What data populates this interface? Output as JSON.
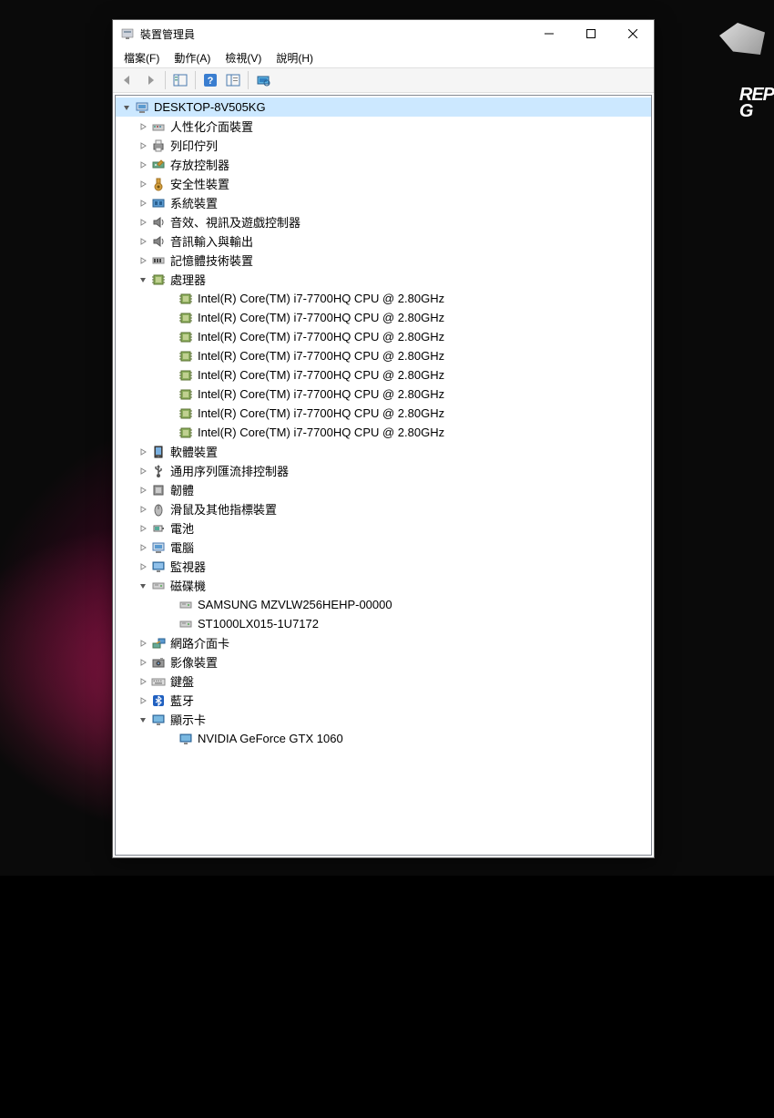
{
  "desktop": {
    "rog_text_line1": "REP",
    "rog_text_line2": "G"
  },
  "window": {
    "title": "裝置管理員"
  },
  "menu": {
    "file": "檔案(F)",
    "action": "動作(A)",
    "view": "檢視(V)",
    "help": "說明(H)"
  },
  "tree": {
    "root": "DESKTOP-8V505KG",
    "nodes": [
      {
        "label": "人性化介面裝置",
        "icon": "hid",
        "expanded": false
      },
      {
        "label": "列印佇列",
        "icon": "printer",
        "expanded": false
      },
      {
        "label": "存放控制器",
        "icon": "storage-ctrl",
        "expanded": false
      },
      {
        "label": "安全性裝置",
        "icon": "security",
        "expanded": false
      },
      {
        "label": "系統裝置",
        "icon": "system",
        "expanded": false
      },
      {
        "label": "音效、視訊及遊戯控制器",
        "icon": "audio",
        "expanded": false
      },
      {
        "label": "音訊輸入與輸出",
        "icon": "audio-io",
        "expanded": false
      },
      {
        "label": "記憶體技術裝置",
        "icon": "memory",
        "expanded": false
      },
      {
        "label": "處理器",
        "icon": "cpu",
        "expanded": true,
        "children": [
          "Intel(R) Core(TM) i7-7700HQ CPU @ 2.80GHz",
          "Intel(R) Core(TM) i7-7700HQ CPU @ 2.80GHz",
          "Intel(R) Core(TM) i7-7700HQ CPU @ 2.80GHz",
          "Intel(R) Core(TM) i7-7700HQ CPU @ 2.80GHz",
          "Intel(R) Core(TM) i7-7700HQ CPU @ 2.80GHz",
          "Intel(R) Core(TM) i7-7700HQ CPU @ 2.80GHz",
          "Intel(R) Core(TM) i7-7700HQ CPU @ 2.80GHz",
          "Intel(R) Core(TM) i7-7700HQ CPU @ 2.80GHz"
        ]
      },
      {
        "label": "軟體裝置",
        "icon": "software",
        "expanded": false
      },
      {
        "label": "通用序列匯流排控制器",
        "icon": "usb",
        "expanded": false
      },
      {
        "label": "韌體",
        "icon": "firmware",
        "expanded": false
      },
      {
        "label": "滑鼠及其他指標裝置",
        "icon": "mouse",
        "expanded": false
      },
      {
        "label": "電池",
        "icon": "battery",
        "expanded": false
      },
      {
        "label": "電腦",
        "icon": "computer",
        "expanded": false
      },
      {
        "label": "監視器",
        "icon": "monitor",
        "expanded": false
      },
      {
        "label": "磁碟機",
        "icon": "disk",
        "expanded": true,
        "children": [
          "SAMSUNG MZVLW256HEHP-00000",
          "ST1000LX015-1U7172"
        ]
      },
      {
        "label": "網路介面卡",
        "icon": "network",
        "expanded": false
      },
      {
        "label": "影像裝置",
        "icon": "imaging",
        "expanded": false
      },
      {
        "label": "鍵盤",
        "icon": "keyboard",
        "expanded": false
      },
      {
        "label": "藍牙",
        "icon": "bluetooth",
        "expanded": false
      },
      {
        "label": "顯示卡",
        "icon": "display",
        "expanded": true,
        "children": [
          "NVIDIA GeForce GTX 1060"
        ]
      }
    ]
  }
}
